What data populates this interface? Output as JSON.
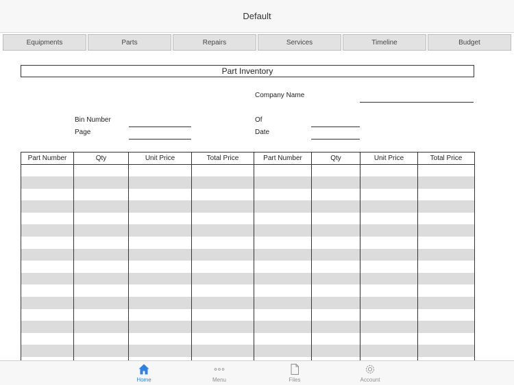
{
  "navbar": {
    "title": "Default"
  },
  "tabs": [
    {
      "label": "Equipments"
    },
    {
      "label": "Parts"
    },
    {
      "label": "Repairs"
    },
    {
      "label": "Services"
    },
    {
      "label": "Timeline"
    },
    {
      "label": "Budget"
    }
  ],
  "form": {
    "title": "Part Inventory",
    "company_name_label": "Company Name",
    "bin_number_label": "Bin Number",
    "page_label": "Page",
    "of_label": "Of",
    "date_label": "Date",
    "columns": [
      "Part Number",
      "Qty",
      "Unit Price",
      "Total Price",
      "Part Number",
      "Qty",
      "Unit Price",
      "Total Price"
    ]
  },
  "bottombar": {
    "items": [
      {
        "label": "Home",
        "icon": "home-icon"
      },
      {
        "label": "Menu",
        "icon": "more-dots-icon"
      },
      {
        "label": "Files",
        "icon": "file-icon"
      },
      {
        "label": "Account",
        "icon": "gear-icon"
      }
    ]
  },
  "colors": {
    "accent": "#2f80e3",
    "stripe": "#dcdcdc",
    "tab_bg": "#e2e2e2"
  }
}
